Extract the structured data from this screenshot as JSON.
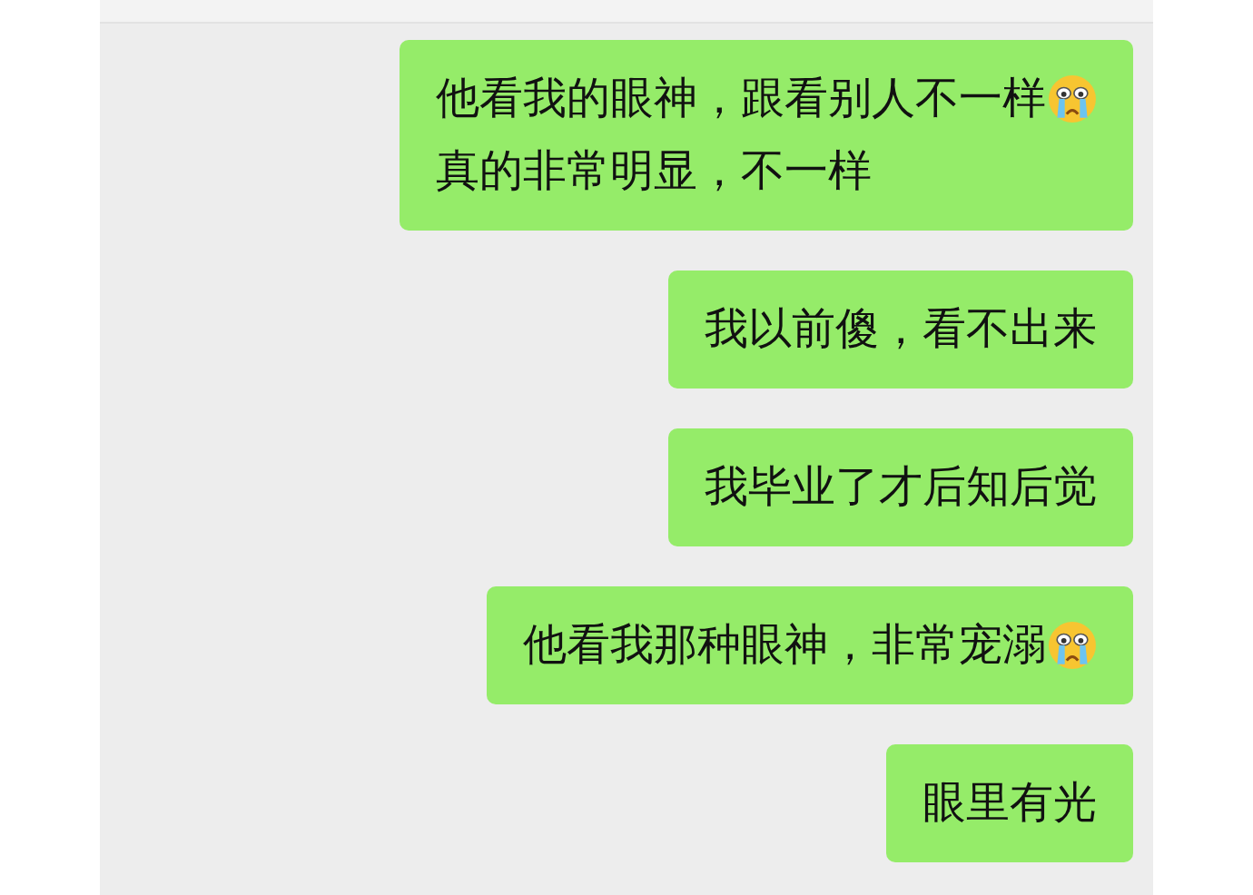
{
  "messages": [
    {
      "lines": [
        {
          "text": "他看我的眼神，跟看别人不一样",
          "emoji": true
        },
        {
          "text": "真的非常明显，不一样",
          "emoji": false
        }
      ]
    },
    {
      "lines": [
        {
          "text": "我以前傻，看不出来",
          "emoji": false
        }
      ]
    },
    {
      "lines": [
        {
          "text": "我毕业了才后知后觉",
          "emoji": false
        }
      ]
    },
    {
      "lines": [
        {
          "text": "他看我那种眼神，非常宠溺",
          "emoji": true
        }
      ]
    },
    {
      "lines": [
        {
          "text": "眼里有光",
          "emoji": false
        }
      ]
    }
  ]
}
